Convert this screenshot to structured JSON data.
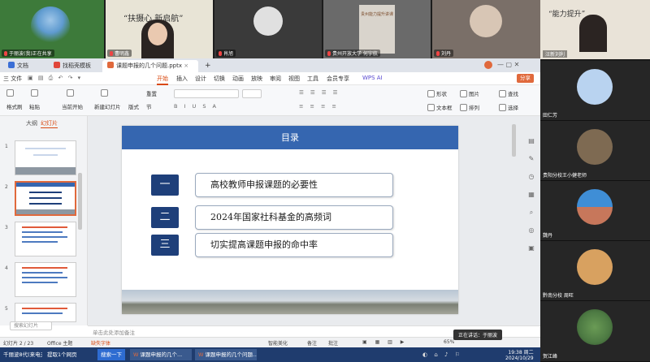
{
  "video_tiles": [
    {
      "caption": "于丽波(我)正在共享",
      "bg": "#3d7a3a"
    },
    {
      "caption": "",
      "bg": "#e8e4d6",
      "banner": "“扶摄心 新启航”"
    },
    {
      "caption": "曹明鑫",
      "bg": "#f3f1ee"
    },
    {
      "caption": "肖旭",
      "bg": "#3a3a3a"
    },
    {
      "caption": "贵州开放大学 何宇航",
      "bg": "#d9d4cc",
      "banner": "贵州能力提升讲课"
    },
    {
      "caption": "刘丹",
      "bg": "#7a6f68"
    }
  ],
  "right_participants": [
    {
      "caption": "汪新刘利",
      "bg": "#e9e3d8",
      "banner": "“能力提升”"
    },
    {
      "caption": "田仁芳",
      "color": "#b9d3f0"
    },
    {
      "caption": "贵阳分校王小健老师",
      "color": "#7e6a52"
    },
    {
      "caption": "魏丹",
      "color": "#c7775b"
    },
    {
      "caption": "黔南分校 周旺",
      "color": "#d8a160"
    },
    {
      "caption": "贺江峰",
      "color": "#4d7a43"
    }
  ],
  "wps": {
    "tabs": [
      "文档",
      "找稻壳模板",
      "课题申报的几个问题.pptx"
    ],
    "menu": [
      "三 文件",
      "开始",
      "插入",
      "设计",
      "切换",
      "动画",
      "放映",
      "审阅",
      "视图",
      "工具",
      "会员专享",
      "WPS AI"
    ],
    "active_menu": "开始",
    "share_label": "分享",
    "ribbon": {
      "format_painter": "格式刷",
      "paste": "粘贴",
      "from_current": "当前开始",
      "new_slide": "新建幻灯片",
      "layout": "版式",
      "section": "节",
      "reset": "重置",
      "shape": "形状",
      "picture": "图片",
      "find": "查找",
      "textbox": "文本框",
      "arrange": "排列",
      "select": "选择"
    },
    "pane_tabs": [
      "大纲",
      "幻灯片"
    ],
    "thumbnail_numbers": [
      "1",
      "2",
      "3",
      "4",
      "5"
    ],
    "slide": {
      "header": "目录",
      "items": [
        {
          "num": "一",
          "text": "高校教师申报课题的必要性"
        },
        {
          "num": "二",
          "text": "2024年国家社科基金的高频词"
        },
        {
          "num": "三",
          "text": "切实提高课题申报的命中率"
        }
      ]
    },
    "notes_placeholder": "单击此处添加备注",
    "status": {
      "slide_count": "幻灯片 2 / 23",
      "theme": "Office 主题",
      "font_missing": "缺失字体",
      "smart_beautify": "智能美化",
      "notes": "备注",
      "comments": "批注",
      "zoom": "65%"
    },
    "search_placeholder": "搜索幻灯片",
    "speaking": "正在讲话：于丽波"
  },
  "taskbar": {
    "items": [
      "千丽波8代(来电无线)",
      "提取1个网页",
      "搜索一下",
      "课题申报的几个...",
      "课题申报的几个问题..."
    ],
    "time": "19:38 周二",
    "date": "2024/10/29"
  }
}
